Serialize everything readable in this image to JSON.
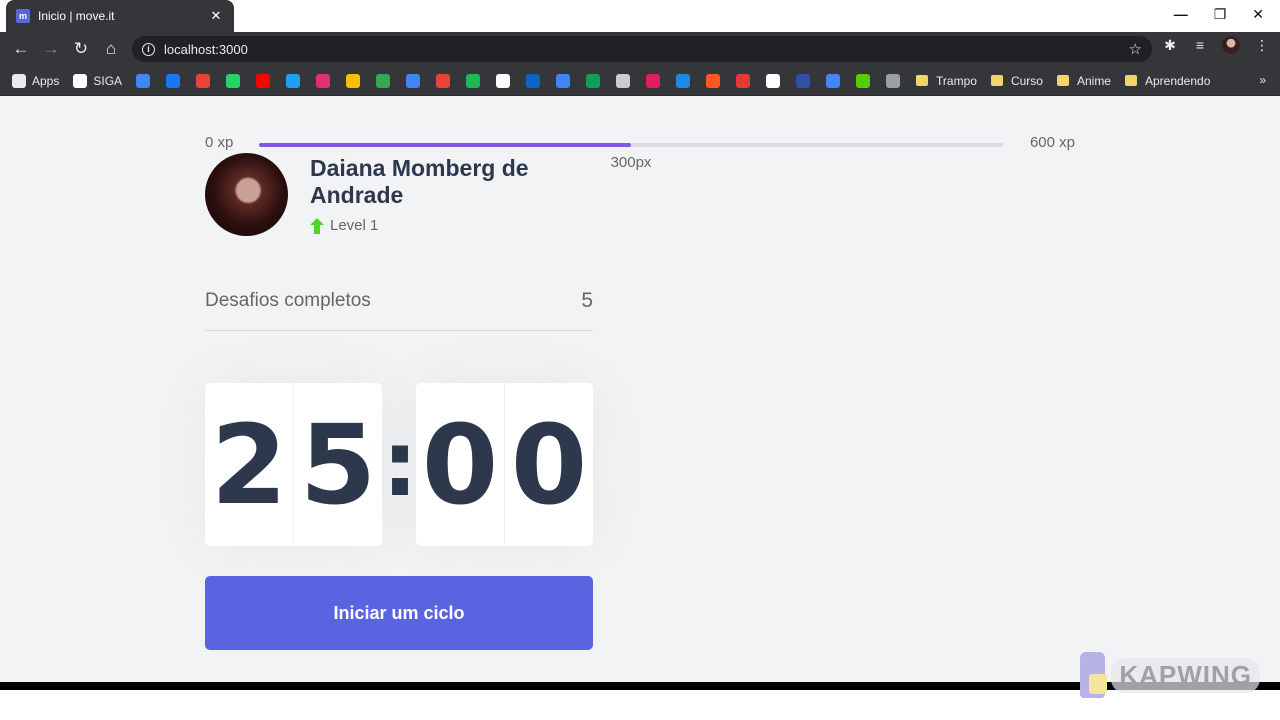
{
  "browser": {
    "tab_title": "Inicio | move.it",
    "tab_favicon": "m",
    "url": "localhost:3000",
    "bookmarks": [
      {
        "label": "Apps",
        "icon": "apps-grid-icon",
        "color": "#e8eaed"
      },
      {
        "label": "SIGA",
        "icon": "globe-icon",
        "color": "#ffffff"
      },
      {
        "label": "",
        "icon": "calendar-icon",
        "color": "#4285f4"
      },
      {
        "label": "",
        "icon": "facebook-icon",
        "color": "#1877f2"
      },
      {
        "label": "",
        "icon": "gmail-icon",
        "color": "#ea4335"
      },
      {
        "label": "",
        "icon": "whatsapp-icon",
        "color": "#25d366"
      },
      {
        "label": "",
        "icon": "youtube-icon",
        "color": "#ff0000"
      },
      {
        "label": "",
        "icon": "twitter-icon",
        "color": "#1da1f2"
      },
      {
        "label": "",
        "icon": "instagram-icon",
        "color": "#e1306c"
      },
      {
        "label": "",
        "icon": "photos-icon",
        "color": "#fbbc04"
      },
      {
        "label": "",
        "icon": "drive-icon",
        "color": "#34a853"
      },
      {
        "label": "",
        "icon": "translate-icon",
        "color": "#4285f4"
      },
      {
        "label": "",
        "icon": "app-10-icon",
        "color": "#ea4335"
      },
      {
        "label": "",
        "icon": "spotify-icon",
        "color": "#1db954"
      },
      {
        "label": "",
        "icon": "github-icon",
        "color": "#ffffff"
      },
      {
        "label": "",
        "icon": "linkedin-icon",
        "color": "#0a66c2"
      },
      {
        "label": "",
        "icon": "docs-icon",
        "color": "#4285f4"
      },
      {
        "label": "",
        "icon": "sheets-icon",
        "color": "#0f9d58"
      },
      {
        "label": "",
        "icon": "bookmark-icon",
        "color": "#cccccc"
      },
      {
        "label": "",
        "icon": "slack-icon",
        "color": "#e01e5a"
      },
      {
        "label": "",
        "icon": "mp3-icon",
        "color": "#1e88e5"
      },
      {
        "label": "",
        "icon": "fire-icon",
        "color": "#ff5722"
      },
      {
        "label": "",
        "icon": "shop-icon",
        "color": "#e53935"
      },
      {
        "label": "",
        "icon": "notion-icon",
        "color": "#ffffff"
      },
      {
        "label": "",
        "icon": "mal-icon",
        "color": "#2e51a2"
      },
      {
        "label": "",
        "icon": "cloud-icon",
        "color": "#4285f4"
      },
      {
        "label": "",
        "icon": "duolingo-icon",
        "color": "#58cc02"
      },
      {
        "label": "",
        "icon": "settings-app-icon",
        "color": "#9aa0a6"
      }
    ],
    "folders": [
      {
        "label": "Trampo"
      },
      {
        "label": "Curso"
      },
      {
        "label": "Anime"
      },
      {
        "label": "Aprendendo"
      }
    ]
  },
  "xp": {
    "min_label": "0 xp",
    "max_label": "600 xp",
    "current_label": "300px",
    "progress_fraction": 0.5,
    "fill_color": "#8257e5"
  },
  "profile": {
    "name": "Daiana Momberg de Andrade",
    "level_label": "Level 1",
    "level_icon": "level-up-arrow-icon",
    "level_icon_color": "#4cd62b"
  },
  "challenges": {
    "label": "Desafios completos",
    "value": "5"
  },
  "countdown": {
    "minute_left": "2",
    "minute_right": "5",
    "separator": ":",
    "second_left": "0",
    "second_right": "0"
  },
  "start_button": {
    "label": "Iniciar um ciclo",
    "color": "#5965e0"
  },
  "watermark": {
    "text": "KAPWING"
  }
}
